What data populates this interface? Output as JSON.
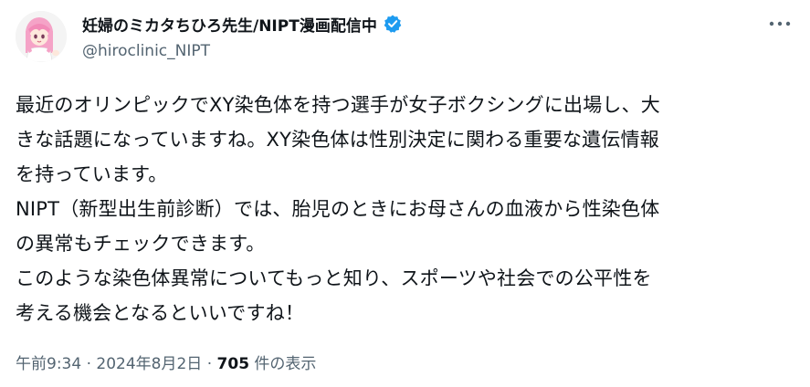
{
  "author": {
    "display_name": "妊婦のミカタちひろ先生/NIPT漫画配信中",
    "handle": "@hiroclinic_NIPT",
    "verified": true,
    "verified_color": "#1d9bf0",
    "avatar_icon": "anime-doctor-avatar"
  },
  "more_icon": "ellipsis-icon",
  "body_lines": [
    "最近のオリンピックでXY染色体を持つ選手が女子ボクシングに出場し、大",
    "きな話題になっていますね。XY染色体は性別決定に関わる重要な遺伝情報",
    "を持っています。",
    "NIPT（新型出生前診断）では、胎児のときにお母さんの血液から性染色体",
    "の異常もチェックできます。",
    "このような染色体異常についてもっと知り、スポーツや社会での公平性を",
    "考える機会となるといいですね！"
  ],
  "meta": {
    "time": "午前9:34",
    "separator": " · ",
    "date": "2024年8月2日",
    "views_count": "705",
    "views_label": " 件の表示"
  }
}
